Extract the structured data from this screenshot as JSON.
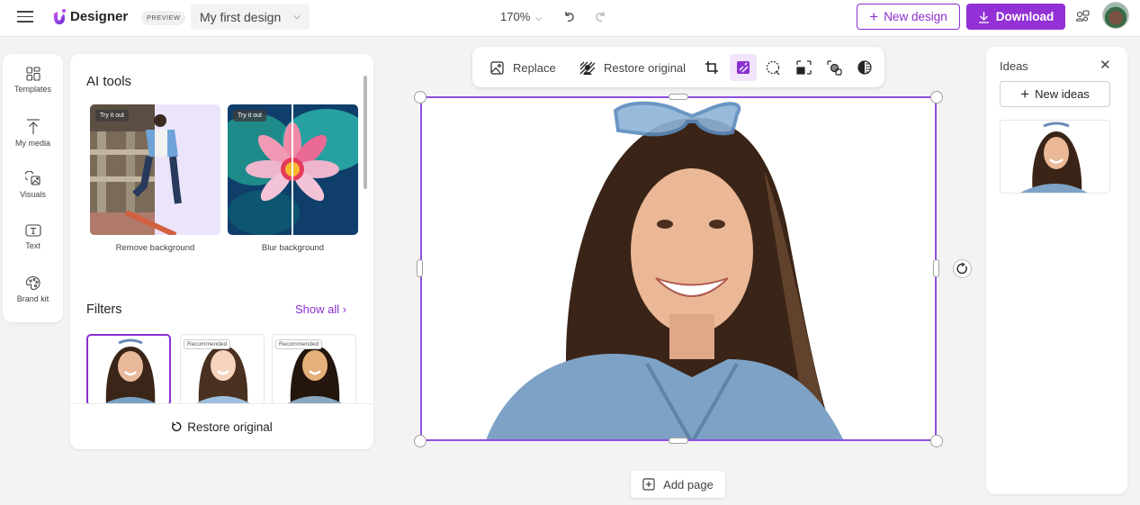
{
  "header": {
    "brand": "Designer",
    "badge": "PREVIEW",
    "design_name": "My first design",
    "zoom_level": "170%",
    "new_design_label": "New design",
    "download_label": "Download"
  },
  "rail": {
    "items": [
      {
        "label": "Templates",
        "icon": "templates-icon"
      },
      {
        "label": "My media",
        "icon": "upload-icon"
      },
      {
        "label": "Visuals",
        "icon": "visuals-icon"
      },
      {
        "label": "Text",
        "icon": "text-icon"
      },
      {
        "label": "Brand kit",
        "icon": "palette-icon"
      }
    ]
  },
  "panel": {
    "ai_tools_heading": "AI tools",
    "tools": [
      {
        "label": "Remove background",
        "badge": "Try it out"
      },
      {
        "label": "Blur background",
        "badge": "Try it out"
      }
    ],
    "filters_heading": "Filters",
    "show_all": "Show all",
    "filters": [
      {
        "badge": "",
        "selected": true
      },
      {
        "badge": "Recommended",
        "selected": false
      },
      {
        "badge": "Recommended",
        "selected": false
      }
    ],
    "footer_label": "Restore original"
  },
  "toolbar": {
    "replace_label": "Replace",
    "restore_label": "Restore original",
    "icons": [
      "crop-icon",
      "magic-edit-icon",
      "lasso-select-icon",
      "frame-icon",
      "blur-bg-icon",
      "adjust-contrast-icon"
    ],
    "active_icon": "magic-edit-icon"
  },
  "canvas": {
    "add_page_label": "Add page"
  },
  "ideas": {
    "heading": "Ideas",
    "new_ideas_label": "New ideas"
  },
  "colors": {
    "accent": "#8a2fd1",
    "download_bg": "#9431d6",
    "selection": "#8f4fe0"
  }
}
